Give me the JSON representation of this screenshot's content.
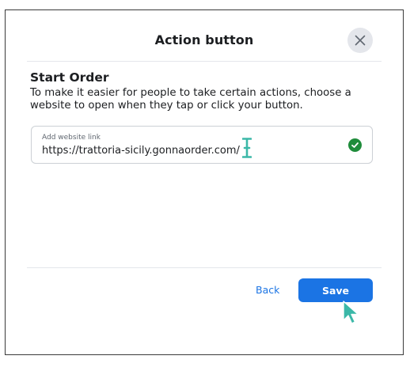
{
  "dialog": {
    "title": "Action button",
    "close_icon": "close-x-icon"
  },
  "content": {
    "heading": "Start Order",
    "description": "To make it easier for people to take certain actions, choose a website to open when they tap or click your button."
  },
  "website_field": {
    "label": "Add website link",
    "value": "https://trattoria-sicily.gonnaorder.com/",
    "status_icon": "check-circle-icon",
    "status_color": "#1f8c3b"
  },
  "footer": {
    "back_label": "Back",
    "save_label": "Save"
  },
  "colors": {
    "primary": "#1b74e4",
    "cursor": "#3bb8a8",
    "close_bg": "#e4e6eb"
  }
}
